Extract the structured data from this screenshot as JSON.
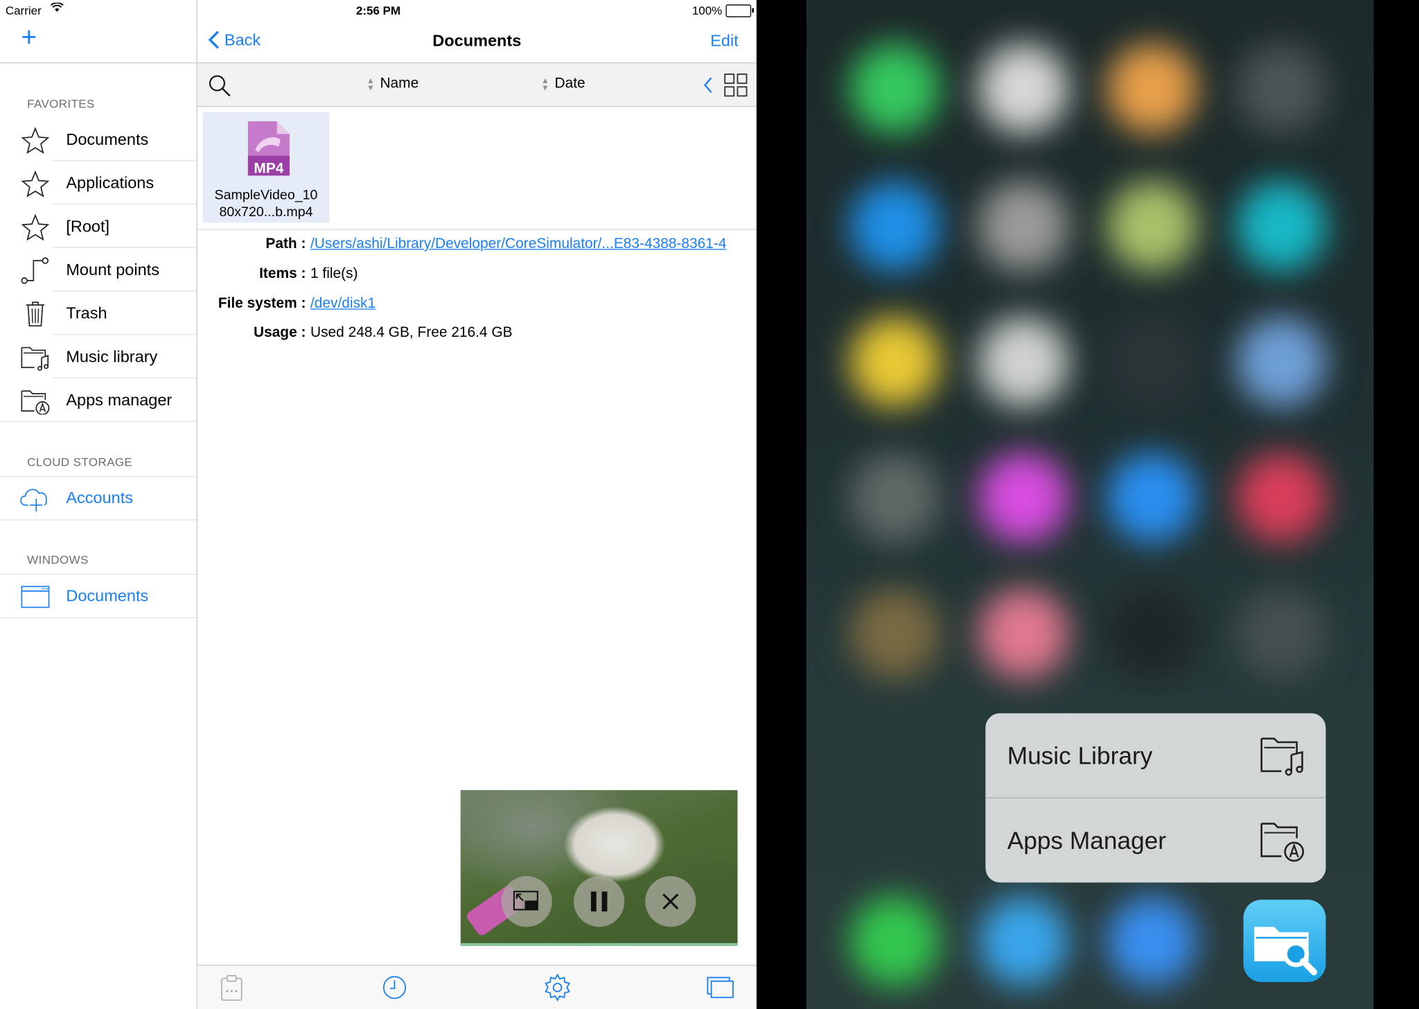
{
  "status": {
    "carrier": "Carrier",
    "time": "2:56 PM",
    "battery": "100%"
  },
  "sidebar": {
    "sections": {
      "favorites": "FAVORITES",
      "cloud": "CLOUD STORAGE",
      "windows": "WINDOWS"
    },
    "items": [
      {
        "label": "Documents",
        "icon": "star-icon"
      },
      {
        "label": "Applications",
        "icon": "star-icon"
      },
      {
        "label": "[Root]",
        "icon": "star-icon"
      },
      {
        "label": "Mount points",
        "icon": "mount-points-icon"
      },
      {
        "label": "Trash",
        "icon": "trash-icon"
      },
      {
        "label": "Music library",
        "icon": "music-folder-icon"
      },
      {
        "label": "Apps manager",
        "icon": "apps-folder-icon"
      }
    ],
    "cloud_items": [
      {
        "label": "Accounts",
        "icon": "cloud-add-icon"
      }
    ],
    "window_items": [
      {
        "label": "Documents",
        "icon": "window-icon"
      }
    ]
  },
  "nav": {
    "back": "Back",
    "title": "Documents",
    "edit": "Edit"
  },
  "toolbar": {
    "sort_name": "Name",
    "sort_date": "Date"
  },
  "files": [
    {
      "name_line1": "SampleVideo_10",
      "name_line2": "80x720...b.mp4",
      "badge": "MP4"
    }
  ],
  "info": {
    "path_label": "Path :",
    "path_value": "/Users/ashi/Library/Developer/CoreSimulator/...E83-4388-8361-4",
    "items_label": "Items :",
    "items_value": "1 file(s)",
    "fs_label": "File system :",
    "fs_value": "/dev/disk1",
    "usage_label": "Usage :",
    "usage_value": "Used 248.4 GB, Free 216.4 GB"
  },
  "quick_actions": [
    {
      "label": "Music Library",
      "icon": "music-folder-icon"
    },
    {
      "label": "Apps Manager",
      "icon": "apps-folder-icon"
    }
  ],
  "colors": {
    "accent": "#1a7ff2",
    "mp4": "#9b3fa6"
  }
}
